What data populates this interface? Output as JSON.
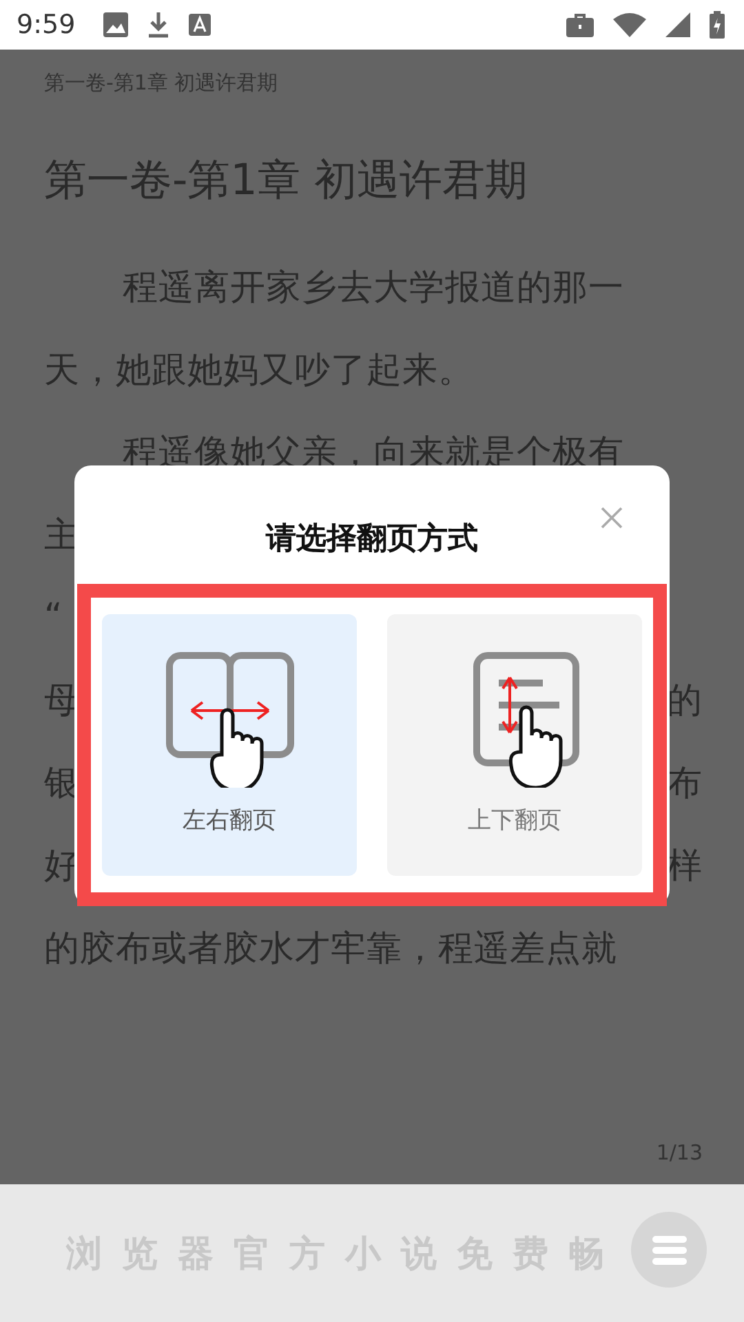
{
  "status_bar": {
    "time": "9:59"
  },
  "reader": {
    "chapter_header": "第一卷-第1章 初遇许君期",
    "title": "第一卷-第1章 初遇许君期",
    "lines": [
      {
        "left": "程遥离开家乡去大学报道的那一",
        "indent": true
      },
      {
        "left": "天，她跟她妈又吵了起来。",
        "indent": false
      },
      {
        "left": "程遥像她父亲，向来就是个极有",
        "indent": true
      },
      {
        "left": "主",
        "indent": false
      },
      {
        "left": "“",
        "indent": false
      },
      {
        "left": "母",
        "right": "的",
        "indent": false
      },
      {
        "left": "银",
        "right": "布",
        "indent": false
      },
      {
        "left": "好",
        "right": "样",
        "indent": false
      },
      {
        "left": "的胶布或者胶水才牢靠，程遥差点就",
        "indent": false
      }
    ],
    "page_number": "1/13"
  },
  "dialog": {
    "title": "请选择翻页方式",
    "options": [
      {
        "label": "左右翻页",
        "kind": "horizontal",
        "selected": true
      },
      {
        "label": "上下翻页",
        "kind": "vertical",
        "selected": false
      }
    ]
  },
  "banner": {
    "text": "浏览器官方小说免费畅"
  }
}
